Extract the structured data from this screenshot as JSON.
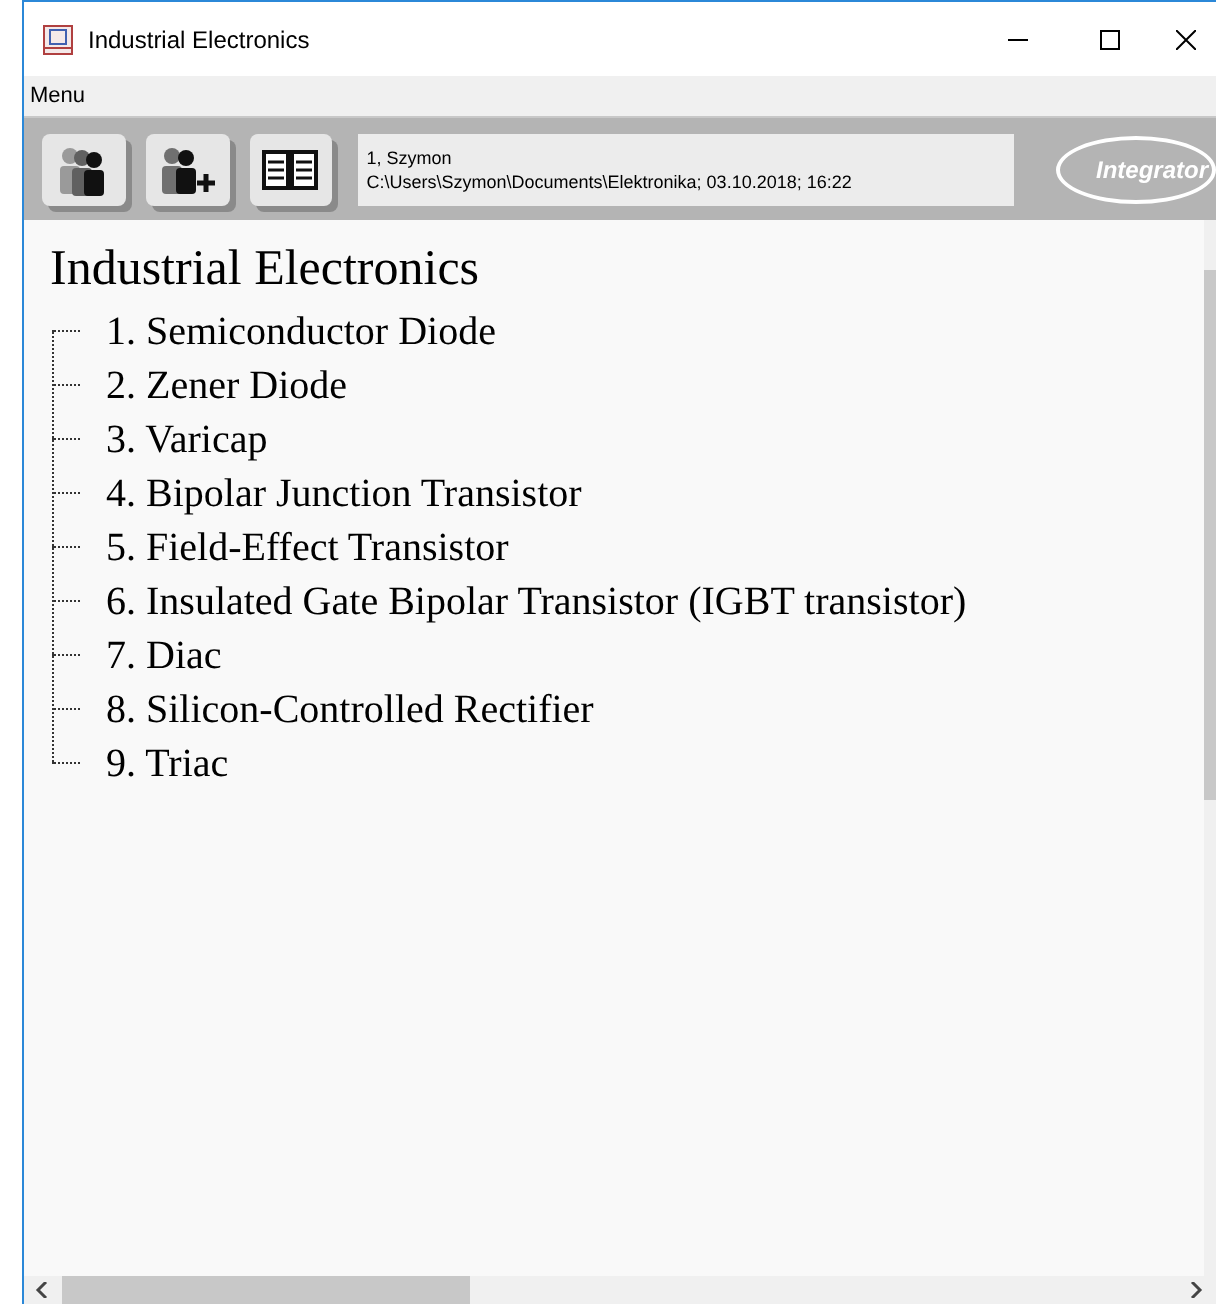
{
  "window": {
    "title": "Industrial Electronics"
  },
  "menu": [
    "Menu"
  ],
  "info": {
    "line_1": "1, Szymon",
    "line_2": "C:\\Users\\Szymon\\Documents\\Elektronika; 03.10.2018; 16:22"
  },
  "logo": {
    "text": "Integrator"
  },
  "content": {
    "heading": "Industrial Electronics",
    "items": [
      {
        "label": "1. Semiconductor Diode"
      },
      {
        "label": "2. Zener Diode"
      },
      {
        "label": "3. Varicap"
      },
      {
        "label": "4. Bipolar Junction Transistor"
      },
      {
        "label": "5. Field-Effect Transistor"
      },
      {
        "label": "6. Insulated Gate Bipolar Transistor (IGBT transistor)"
      },
      {
        "label": "7. Diac"
      },
      {
        "label": "8. Silicon-Controlled Rectifier"
      },
      {
        "label": "9. Triac"
      }
    ]
  }
}
